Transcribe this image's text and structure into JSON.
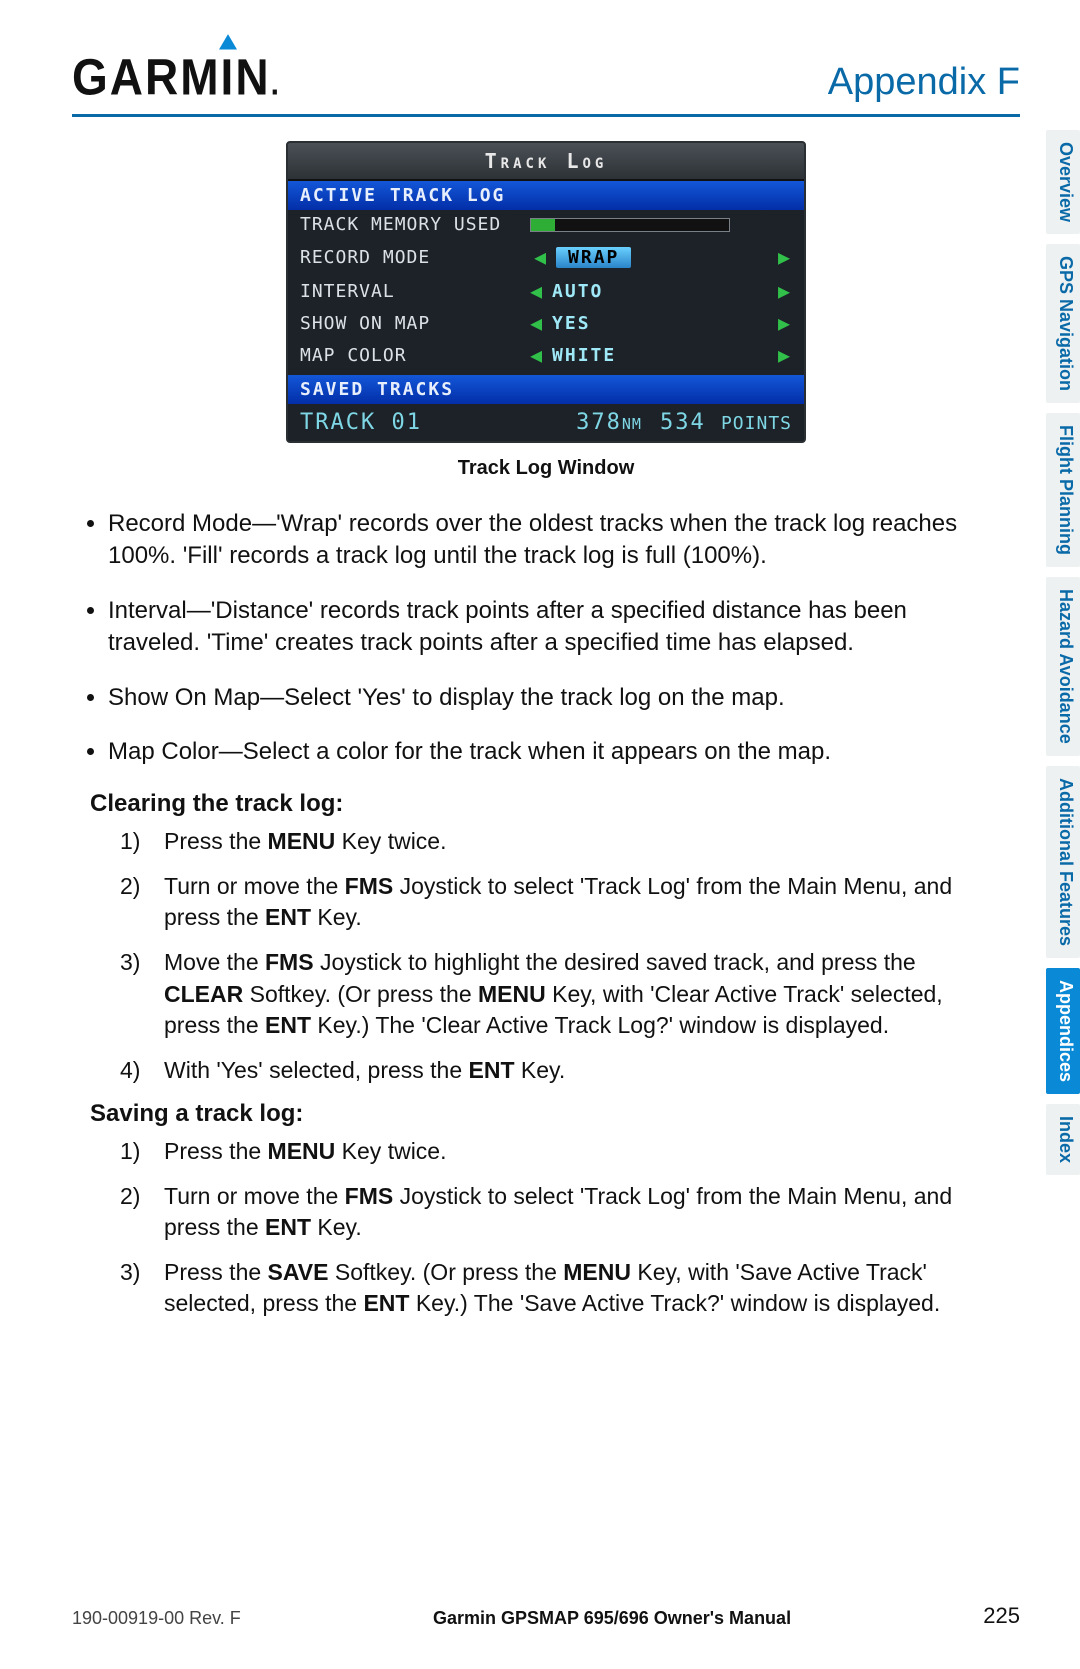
{
  "header": {
    "brand": "GARMIN",
    "section": "Appendix F"
  },
  "side_tabs": {
    "items": [
      {
        "label": "Overview",
        "active": false
      },
      {
        "label": "GPS Navigation",
        "active": false
      },
      {
        "label": "Flight Planning",
        "active": false
      },
      {
        "label": "Hazard Avoidance",
        "active": false
      },
      {
        "label": "Additional Features",
        "active": false
      },
      {
        "label": "Appendices",
        "active": true
      },
      {
        "label": "Index",
        "active": false
      }
    ]
  },
  "screenshot": {
    "title": "Track Log",
    "active_header": "ACTIVE TRACK LOG",
    "rows": {
      "memory_label": "TRACK MEMORY USED",
      "record_mode_label": "RECORD MODE",
      "record_mode_value": "WRAP",
      "interval_label": "INTERVAL",
      "interval_value": "AUTO",
      "show_label": "SHOW ON MAP",
      "show_value": "YES",
      "color_label": "MAP COLOR",
      "color_value": "WHITE"
    },
    "saved_header": "SAVED TRACKS",
    "saved_track": {
      "name": "TRACK 01",
      "distance": "378",
      "distance_units": "NM",
      "points": "534",
      "points_label": "Points"
    },
    "caption": "Track Log Window"
  },
  "bullets": [
    "Record Mode—'Wrap' records over the oldest tracks when the track log reaches 100%.  'Fill' records a track log until the track log is full (100%).",
    "Interval—'Distance' records track points after a specified distance has been traveled.  'Time' creates track points after a specified time has elapsed.",
    "Show On Map—Select 'Yes' to display the track log on the map.",
    "Map Color—Select a color for the track when it appears on the map."
  ],
  "procedures": {
    "clear": {
      "heading": "Clearing the track log:",
      "steps": [
        {
          "parts": [
            "Press the ",
            {
              "b": "MENU"
            },
            " Key twice."
          ]
        },
        {
          "parts": [
            "Turn or move the ",
            {
              "b": "FMS"
            },
            " Joystick to select 'Track Log' from the Main Menu, and press the ",
            {
              "b": "ENT"
            },
            " Key."
          ]
        },
        {
          "parts": [
            "Move the ",
            {
              "b": "FMS"
            },
            " Joystick to highlight the desired saved track, and press the ",
            {
              "b": "CLEAR"
            },
            " Softkey.  (Or press the ",
            {
              "b": "MENU"
            },
            " Key, with 'Clear Active Track' selected, press the ",
            {
              "b": "ENT"
            },
            " Key.)  The 'Clear Active Track Log?' window is displayed."
          ]
        },
        {
          "parts": [
            "With 'Yes' selected, press the ",
            {
              "b": "ENT"
            },
            " Key."
          ]
        }
      ]
    },
    "save": {
      "heading": "Saving a track log:",
      "steps": [
        {
          "parts": [
            "Press the ",
            {
              "b": "MENU"
            },
            " Key twice."
          ]
        },
        {
          "parts": [
            "Turn or move the ",
            {
              "b": "FMS"
            },
            " Joystick to select 'Track Log' from the Main Menu, and press the ",
            {
              "b": "ENT"
            },
            " Key."
          ]
        },
        {
          "parts": [
            "Press the ",
            {
              "b": "SAVE"
            },
            " Softkey.  (Or press the ",
            {
              "b": "MENU"
            },
            " Key, with 'Save Active Track' selected, press the ",
            {
              "b": "ENT"
            },
            " Key.)  The 'Save Active Track?' window is displayed."
          ]
        }
      ]
    }
  },
  "footer": {
    "revision": "190-00919-00  Rev. F",
    "manual_title": "Garmin GPSMAP 695/696 Owner's Manual",
    "page": "225"
  }
}
